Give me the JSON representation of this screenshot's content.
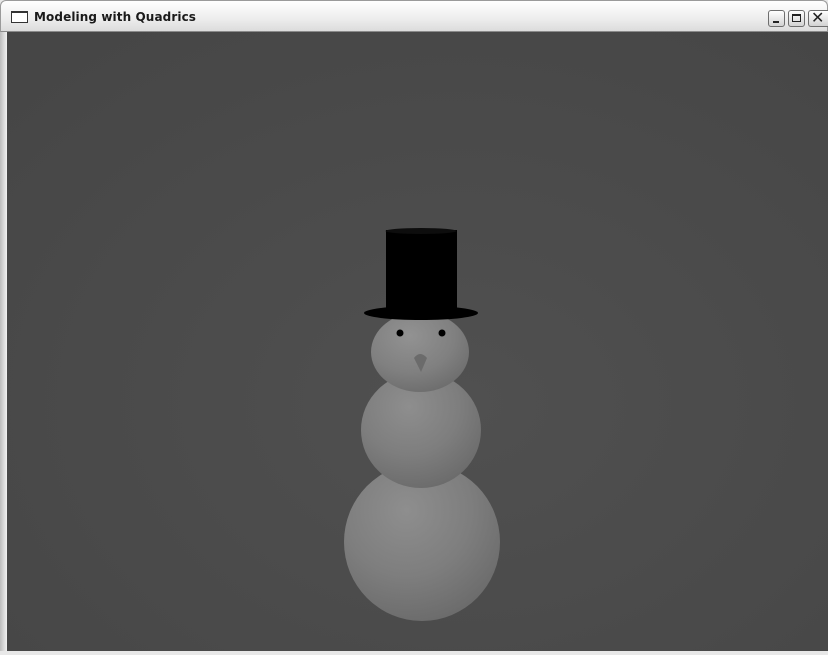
{
  "window": {
    "title": "Modeling with Quadrics",
    "controls": {
      "minimize_icon": "minimize-icon",
      "maximize_icon": "maximize-icon",
      "close_icon": "close-icon",
      "close_glyph": "✕"
    }
  },
  "scene": {
    "background_color": "#4a4a4a",
    "object": "snowman",
    "body_color": "#8a8a8a",
    "hat_color": "#000000",
    "nose_color": "#6e6e6e"
  }
}
